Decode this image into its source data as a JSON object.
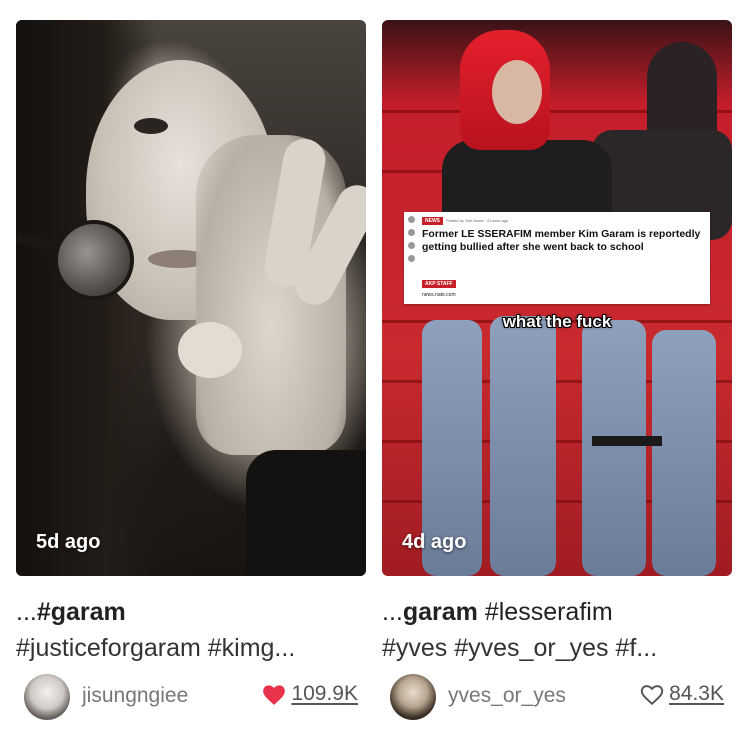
{
  "cards": [
    {
      "time_ago": "5d ago",
      "caption_line1_prefix": "...",
      "caption_line1_bold": "#garam",
      "caption_line1_rest": "",
      "caption_line2": "#justiceforgaram #kimg...",
      "username": "jisungngiee",
      "likes": "109.9K",
      "liked": true
    },
    {
      "time_ago": "4d ago",
      "caption_line1_prefix": "...",
      "caption_line1_bold": "garam",
      "caption_line1_rest": " #lesserafim",
      "caption_line2": "#yves #yves_or_yes #f...",
      "username": "yves_or_yes",
      "likes": "84.3K",
      "liked": false,
      "news_overlay": {
        "badge": "NEWS",
        "meta": "Posted by Yuki Ames · 4 hours ago",
        "headline": "Former LE SSERAFIM member Kim Garam is reportedly getting bullied after she went back to school",
        "staff_tag": "AKP STAFF",
        "site": "news.nate.com"
      },
      "overlay_caption": "what the fuck"
    }
  ],
  "colors": {
    "heart_filled": "#e8334a",
    "heart_outline": "#555555",
    "text_primary": "#222222",
    "text_secondary": "#777777"
  },
  "icons": {
    "like_filled": "heart-filled-icon",
    "like_outline": "heart-outline-icon"
  }
}
